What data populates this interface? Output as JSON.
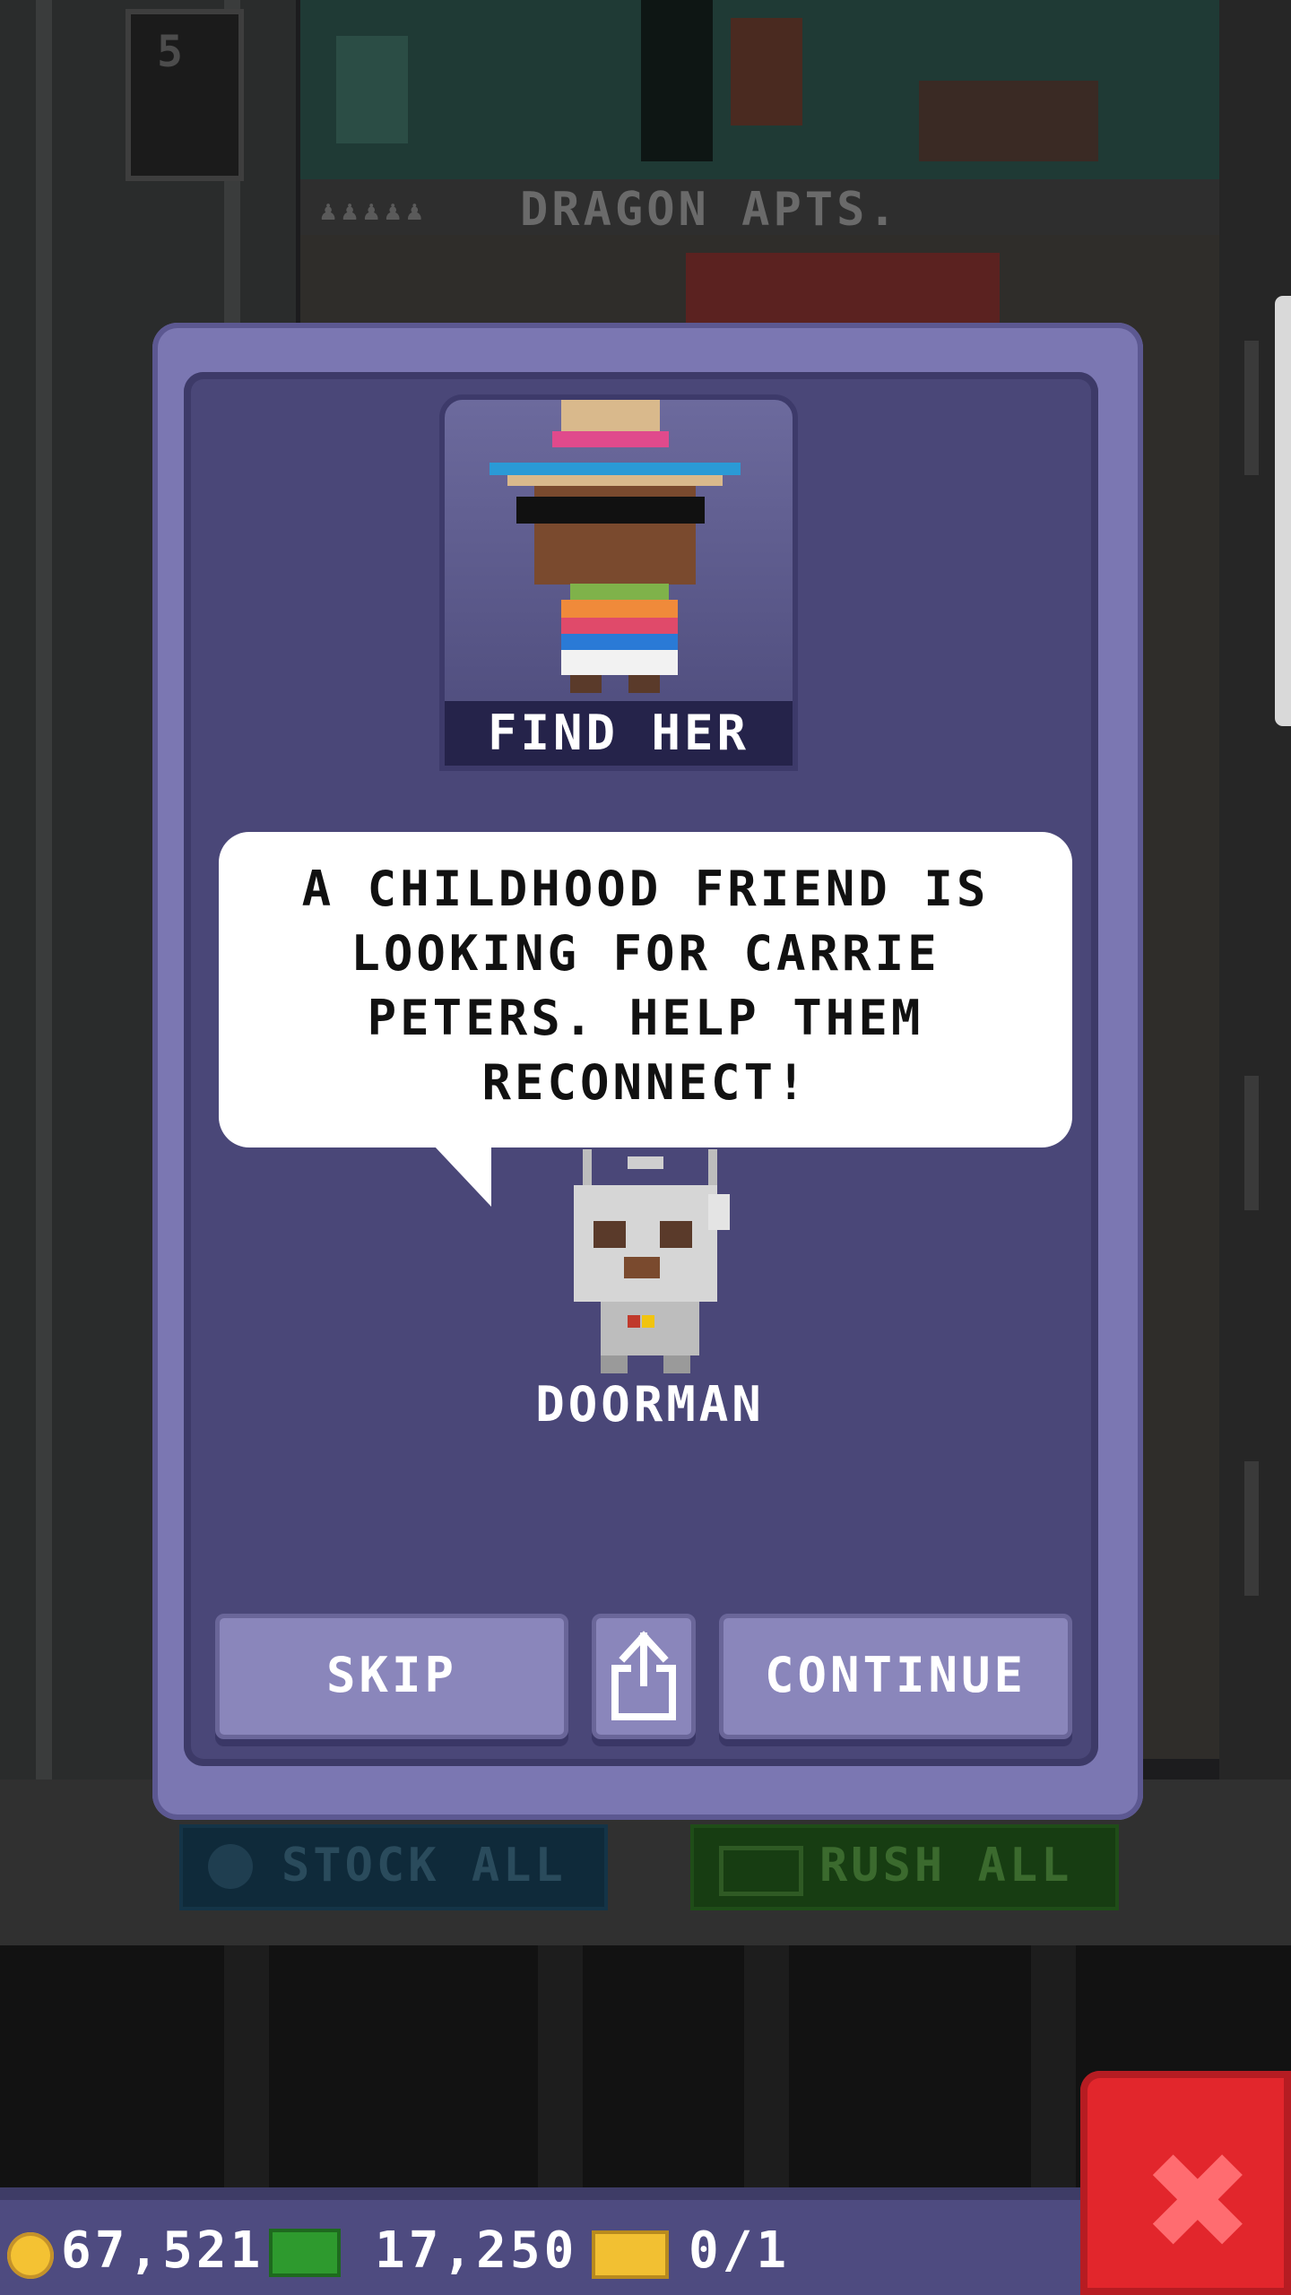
{
  "background": {
    "floor_number": "5",
    "building_sign": "DRAGON APTS.",
    "stock_all_label": "STOCK ALL",
    "rush_all_label": "RUSH ALL"
  },
  "dialog": {
    "mission_title": "FIND HER",
    "message": "A CHILDHOOD FRIEND IS LOOKING FOR CARRIE PETERS. HELP THEM RECONNECT!",
    "speaker": "DOORMAN",
    "skip_label": "SKIP",
    "continue_label": "CONTINUE",
    "share_icon": "share-icon"
  },
  "hud": {
    "coins": "67,521",
    "bux": "17,250",
    "tickets": "0/1",
    "close_icon": "close-icon"
  },
  "colors": {
    "modal_outer": "#7b77b2",
    "modal_inner": "#4a4778",
    "button": "#8a86bb",
    "close_button": "#e2262c",
    "coin": "#f4c233",
    "bux": "#2e9a2e"
  }
}
